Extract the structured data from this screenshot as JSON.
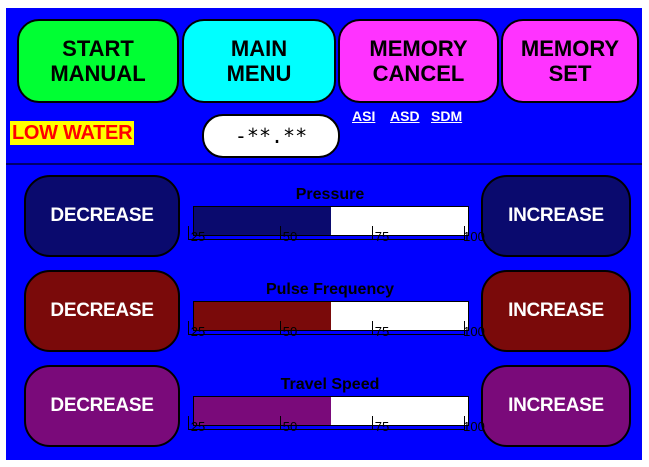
{
  "top_buttons": {
    "start_manual": {
      "line1": "START",
      "line2": "MANUAL"
    },
    "main_menu": {
      "line1": "MAIN",
      "line2": "MENU"
    },
    "memory_cancel": {
      "line1": "MEMORY",
      "line2": "CANCEL"
    },
    "memory_set": {
      "line1": "MEMORY",
      "line2": "SET"
    }
  },
  "status": {
    "low_water_label": "LOW WATER",
    "readout_value": "-**.**"
  },
  "links": [
    "ASI",
    "ASD",
    "SDM"
  ],
  "gauges": [
    {
      "title": "Pressure",
      "decrease_label": "DECREASE",
      "increase_label": "INCREASE",
      "value_percent_of_scale": 0.5,
      "scale": [
        "25",
        "50",
        "75",
        "100"
      ],
      "button_color": "#0a0a6e",
      "fill_color": "#0a0a6e"
    },
    {
      "title": "Pulse Frequency",
      "decrease_label": "DECREASE",
      "increase_label": "INCREASE",
      "value_percent_of_scale": 0.5,
      "scale": [
        "25",
        "50",
        "75",
        "100"
      ],
      "button_color": "#7a0a0a",
      "fill_color": "#7a0a0a"
    },
    {
      "title": "Travel Speed",
      "decrease_label": "DECREASE",
      "increase_label": "INCREASE",
      "value_percent_of_scale": 0.5,
      "scale": [
        "25",
        "50",
        "75",
        "100"
      ],
      "button_color": "#7a0a7a",
      "fill_color": "#7a0a7a"
    }
  ]
}
